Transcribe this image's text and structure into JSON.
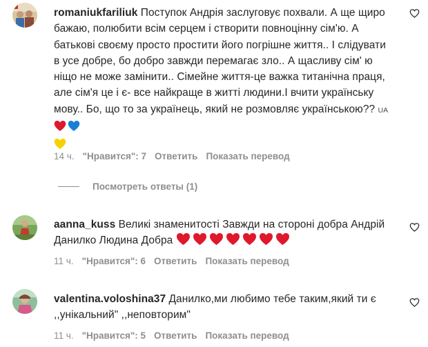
{
  "comments": [
    {
      "username": "romaniukfariliuk",
      "text": "Поступок Андрія заслуговує похвали. А ще щиро бажаю, полюбити всім серцем і створити повноцінну сім'ю. А батькові своєму просто простити його погрішне життя.. І слідувати в усе добре, бо добро завжди перемагає зло.. А щасливу сім' ю ніщо не може замінити.. Сімейне життя-це важка титанічна праця, але сім'я це і є- все найкраще в житті людини.І вчити українську мову.. Бо, що то за українець, який не розмовляє українською?? ",
      "flag_text": "UA",
      "time": "14 ч.",
      "likes": "\"Нравится\": 7",
      "reply": "Ответить",
      "translate": "Показать перевод",
      "view_replies": "Посмотреть ответы (1)"
    },
    {
      "username": "aanna_kuss",
      "text": "Великі знаменитості Завжди на стороні добра Андрій Данилко Людина Добра",
      "time": "11 ч.",
      "likes": "\"Нравится\": 6",
      "reply": "Ответить",
      "translate": "Показать перевод"
    },
    {
      "username": "valentina.voloshina37",
      "text": "Данилко,ми любимо тебе таким,який ти є ,,унікальний\" ,,неповторим\"",
      "time": "11 ч.",
      "likes": "\"Нравится\": 5",
      "reply": "Ответить",
      "translate": "Показать перевод"
    }
  ],
  "colors": {
    "text": "#262626",
    "muted": "#8e8e8e",
    "heart_red": "#e0182d",
    "heart_blue": "#1a7fd4",
    "heart_yellow": "#f5d300"
  },
  "icons": [
    "heart-outline-icon",
    "red-heart-emoji",
    "blue-heart-emoji",
    "yellow-heart-emoji"
  ]
}
